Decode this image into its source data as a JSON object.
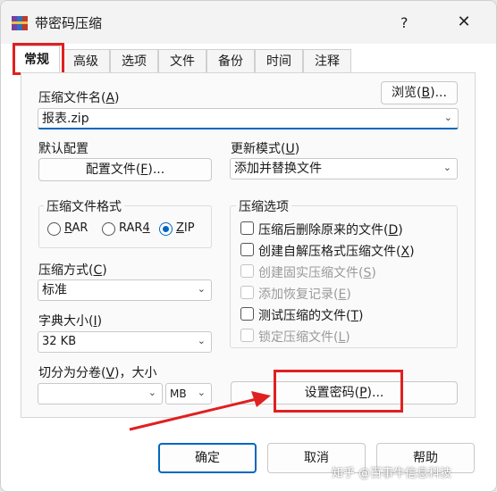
{
  "window": {
    "title": "带密码压缩",
    "help_glyph": "?",
    "close_glyph": "✕"
  },
  "tabs": [
    {
      "label": "常规",
      "active": true
    },
    {
      "label": "高级"
    },
    {
      "label": "选项"
    },
    {
      "label": "文件"
    },
    {
      "label": "备份"
    },
    {
      "label": "时间"
    },
    {
      "label": "注释"
    }
  ],
  "archive": {
    "name_label_pre": "压缩文件名(",
    "name_label_key": "A",
    "name_label_post": ")",
    "browse_pre": "浏览(",
    "browse_key": "B",
    "browse_post": ")...",
    "name_value": "报表.zip"
  },
  "profile": {
    "label": "默认配置",
    "button_pre": "配置文件(",
    "button_key": "F",
    "button_post": ")..."
  },
  "update_mode": {
    "label_pre": "更新模式(",
    "label_key": "U",
    "label_post": ")",
    "value": "添加并替换文件"
  },
  "format": {
    "title": "压缩文件格式",
    "options": [
      {
        "label_key": "R",
        "label_rest": "AR",
        "checked": false
      },
      {
        "label_pre": "RAR",
        "label_key": "4",
        "checked": false
      },
      {
        "label_key": "Z",
        "label_rest": "IP",
        "checked": true
      }
    ]
  },
  "options": {
    "title": "压缩选项",
    "items": [
      {
        "pre": "压缩后删除原来的文件(",
        "key": "D",
        "post": ")",
        "enabled": true
      },
      {
        "pre": "创建自解压格式压缩文件(",
        "key": "X",
        "post": ")",
        "enabled": true
      },
      {
        "pre": "创建固实压缩文件(",
        "key": "S",
        "post": ")",
        "enabled": false
      },
      {
        "pre": "添加恢复记录(",
        "key": "E",
        "post": ")",
        "enabled": false
      },
      {
        "pre": "测试压缩的文件(",
        "key": "T",
        "post": ")",
        "enabled": true
      },
      {
        "pre": "锁定压缩文件(",
        "key": "L",
        "post": ")",
        "enabled": false
      }
    ]
  },
  "method": {
    "label_pre": "压缩方式(",
    "label_key": "C",
    "label_post": ")",
    "value": "标准"
  },
  "dict": {
    "label_pre": "字典大小(",
    "label_key": "I",
    "label_post": ")",
    "value": "32 KB"
  },
  "split": {
    "label_pre": "切分为分卷(",
    "label_key": "V",
    "label_post": ")，大小",
    "value": "",
    "unit": "MB"
  },
  "password": {
    "pre": "设置密码(",
    "key": "P",
    "post": ")..."
  },
  "buttons": {
    "ok": "确定",
    "cancel": "取消",
    "help": "帮助"
  },
  "watermark": "知乎 @百事牛信息科技",
  "colors": {
    "accent": "#0067c0",
    "highlight": "#e02020"
  }
}
